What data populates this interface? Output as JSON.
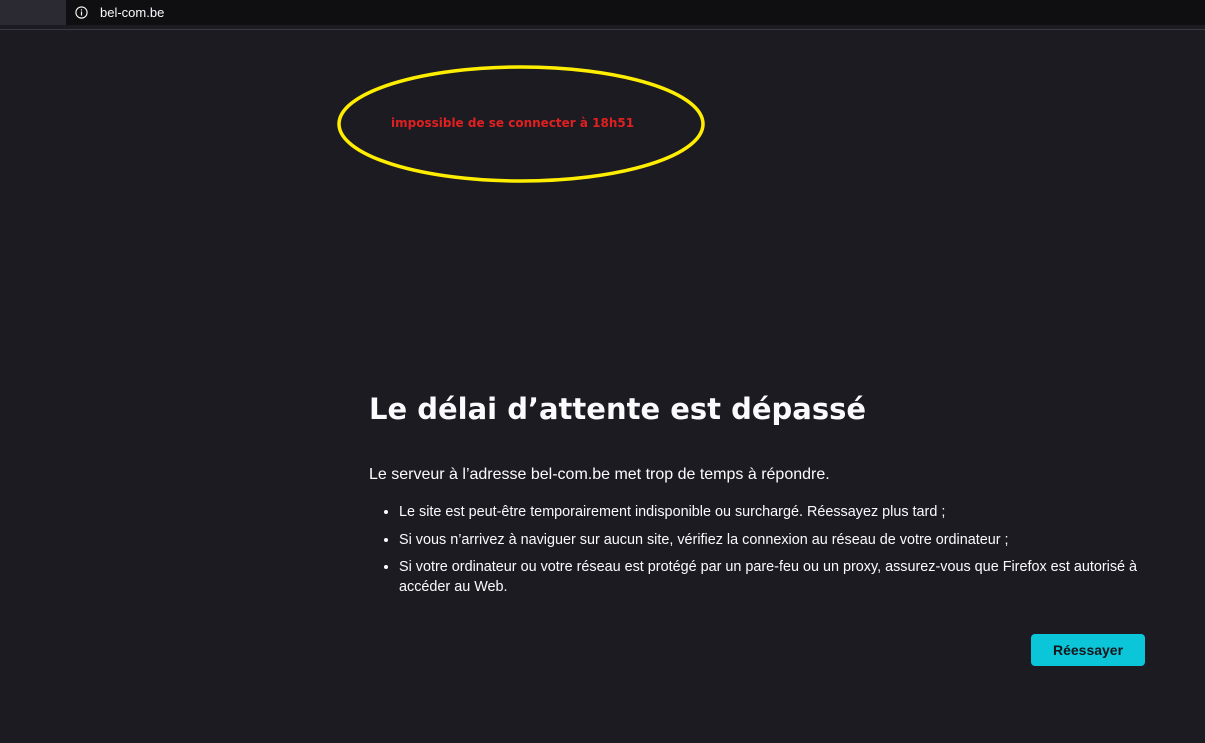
{
  "urlbar": {
    "url": "bel-com.be",
    "icon": "info-icon"
  },
  "annotation": {
    "text": "impossible de se connecter à 18h51",
    "circle_color": "#ffee00",
    "text_color": "#e02020"
  },
  "error": {
    "title": "Le délai d’attente est dépassé",
    "description": "Le serveur à l’adresse bel-com.be met trop de temps à répondre.",
    "suggestions": [
      "Le site est peut-être temporairement indisponible ou surchargé. Réessayez plus tard ;",
      "Si vous n’arrivez à naviguer sur aucun site, vérifiez la connexion au réseau de votre ordinateur ;",
      "Si votre ordinateur ou votre réseau est protégé par un pare-feu ou un proxy, assurez-vous que Firefox est autorisé à accéder au Web."
    ],
    "retry_label": "Réessayer"
  },
  "colors": {
    "background": "#1c1b22",
    "accent": "#0bc5d8",
    "text": "#fbfbfe"
  }
}
